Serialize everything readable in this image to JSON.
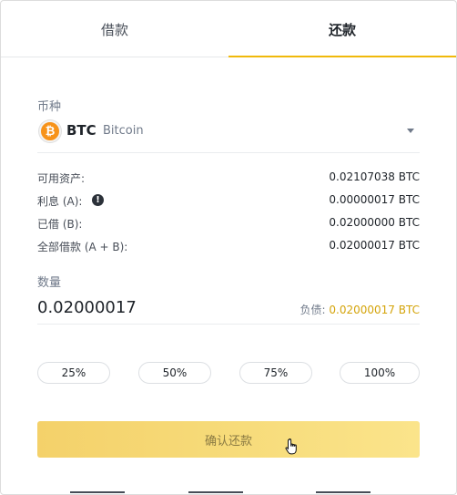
{
  "tabs": [
    {
      "label": "借款",
      "active": false
    },
    {
      "label": "还款",
      "active": true
    }
  ],
  "currency": {
    "label": "币种",
    "symbol": "BTC",
    "name": "Bitcoin",
    "icon": "bitcoin-icon",
    "icon_glyph": "₿"
  },
  "info": {
    "available_label": "可用资产:",
    "available_value": "0.02107038 BTC",
    "interest_label": "利息 (A):",
    "interest_value": "0.00000017 BTC",
    "warn_glyph": "!",
    "borrowed_label": "已借 (B):",
    "borrowed_value": "0.02000000 BTC",
    "total_label": "全部借款 (A + B):",
    "total_value": "0.02000017 BTC"
  },
  "amount": {
    "label": "数量",
    "value": "0.02000017",
    "debt_label": "负债:",
    "debt_value": "0.02000017",
    "debt_unit": "BTC"
  },
  "percent_buttons": [
    "25%",
    "50%",
    "75%",
    "100%"
  ],
  "confirm_label": "确认还款",
  "colors": {
    "accent": "#f0b90b",
    "bitcoin": "#f7931a",
    "confirm_gradient_start": "#f4d16a",
    "confirm_gradient_end": "#fbe48b"
  }
}
